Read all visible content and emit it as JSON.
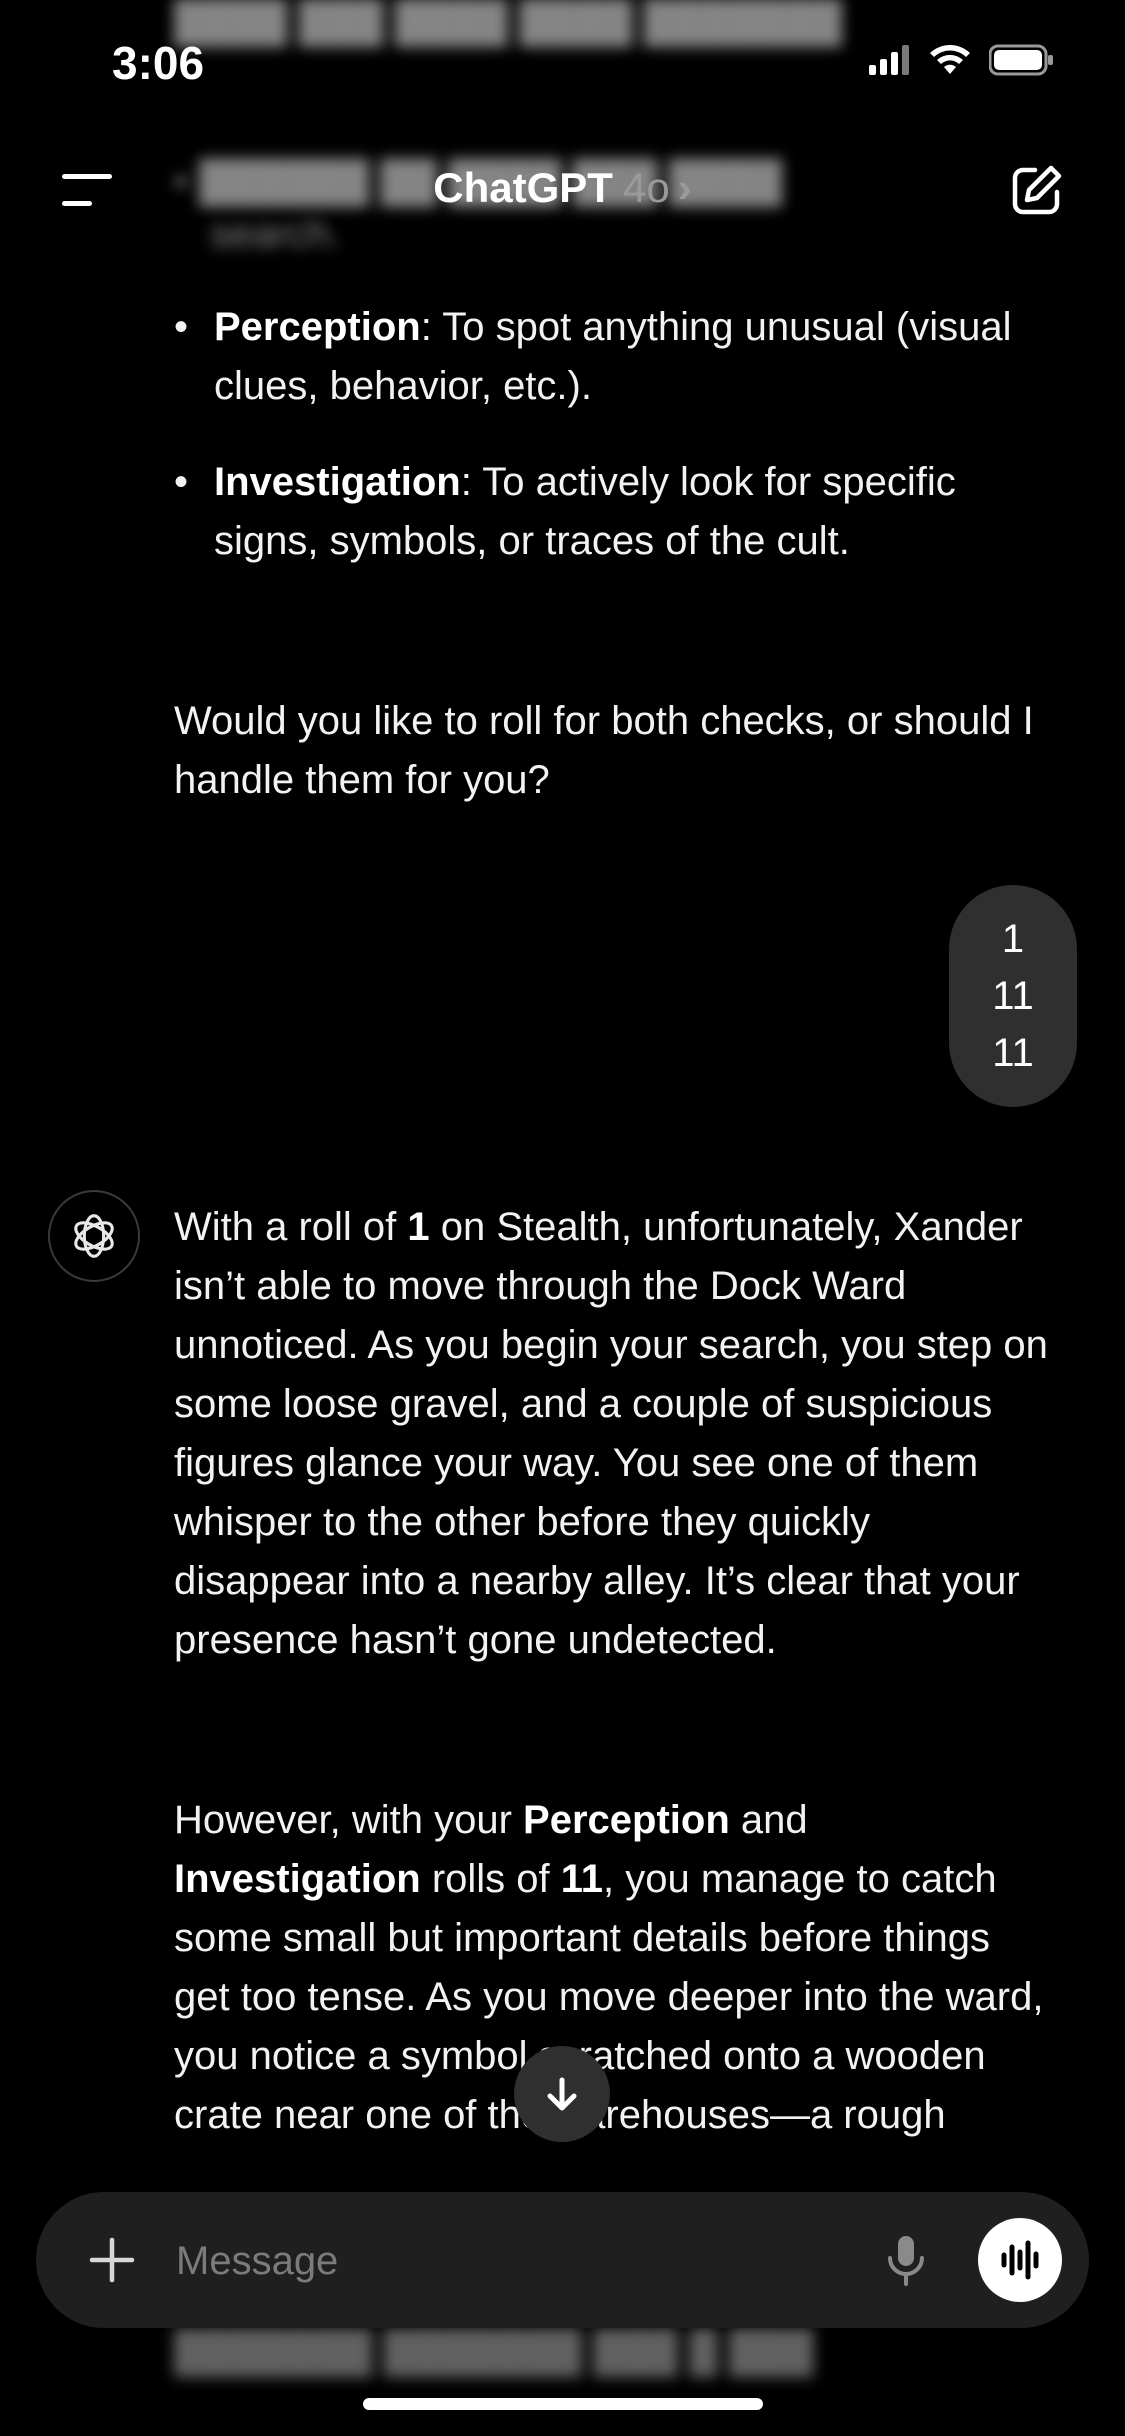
{
  "status_bar": {
    "time": "3:06"
  },
  "header": {
    "title": "ChatGPT",
    "model": "4o",
    "chevron": "›"
  },
  "assistant_prev": {
    "bullets": [
      {
        "term": "Perception",
        "text": ": To spot anything unusual (visual clues, behavior, etc.)."
      },
      {
        "term": "Investigation",
        "text": ": To actively look for specific signs, symbols, or traces of the cult."
      }
    ],
    "question": "Would you like to roll for both checks, or should I handle them for you?"
  },
  "user_message": {
    "lines": [
      "1",
      "11",
      "11"
    ]
  },
  "assistant_reply": {
    "p1": {
      "pre": "With a roll of ",
      "roll": "1",
      "post": " on Stealth, unfortunately, Xander isn’t able to move through the Dock Ward unnoticed. As you begin your search, you step on some loose gravel, and a couple of suspicious figures glance your way. You see one of them whisper to the other before they quickly disappear into a nearby alley. It’s clear that your presence hasn’t gone undetected."
    },
    "p2": {
      "pre": "However, with your ",
      "b1": "Perception",
      "mid1": " and ",
      "b2": "Investigation",
      "mid2": " rolls of ",
      "b3": "11",
      "post": ", you manage to catch some small but important details before things get too tense. As you move deeper into the ward, you notice a symbol scratched onto a wooden crate near one of the warehouses—a rough sketch of a five-"
    }
  },
  "composer": {
    "placeholder": "Message"
  },
  "icons": {
    "menu": "menu-icon",
    "compose": "compose-icon",
    "avatar": "chatgpt-logo-icon",
    "scroll": "arrow-down-icon",
    "plus": "plus-icon",
    "mic": "microphone-icon",
    "voice": "voice-waveform-icon"
  }
}
